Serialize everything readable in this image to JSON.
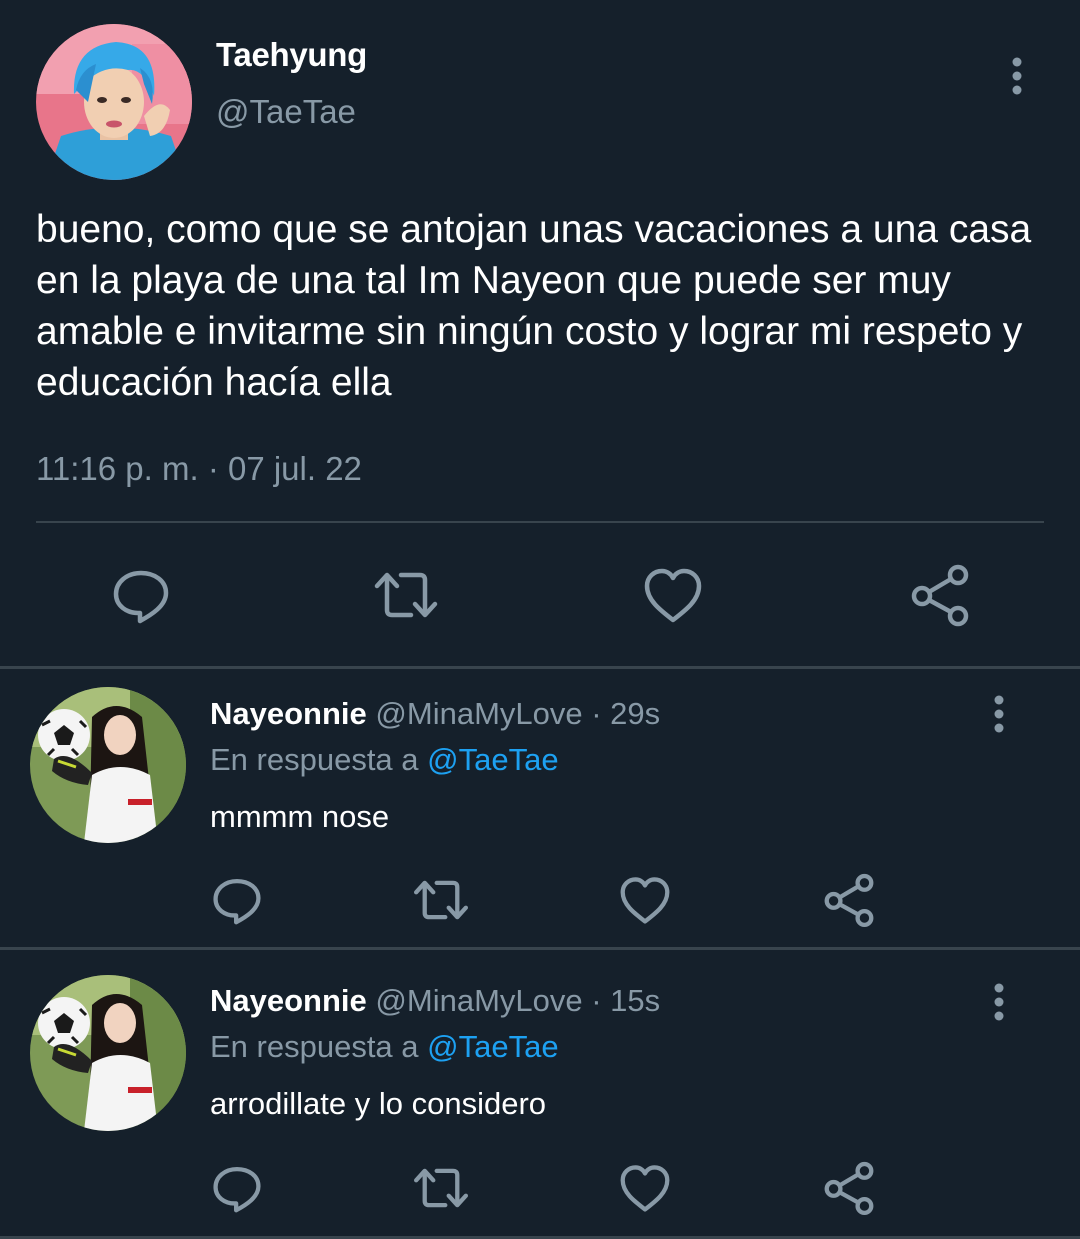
{
  "main_tweet": {
    "display_name": "Taehyung",
    "handle": "@TaeTae",
    "text": "bueno, como que se antojan unas vacaciones a una casa en la playa de una tal Im Nayeon que puede ser muy amable e invitarme sin ningún costo y lograr mi respeto y educación hacía ella",
    "timestamp": "11:16 p. m. · 07 jul. 22",
    "avatar": "blue-haired-man-avatar"
  },
  "replies": [
    {
      "display_name": "Nayeonnie",
      "handle_time": "@MinaMyLove · 29s",
      "replying_prefix": "En respuesta a",
      "replying_to": "@TaeTae",
      "text": "mmmm nose",
      "avatar": "woman-with-soccer-ball-avatar"
    },
    {
      "display_name": "Nayeonnie",
      "handle_time": "@MinaMyLove · 15s",
      "replying_prefix": "En respuesta a",
      "replying_to": "@TaeTae",
      "text": "arrodillate y lo considero",
      "avatar": "woman-with-soccer-ball-avatar"
    }
  ],
  "icons": {
    "reply": "reply-icon",
    "retweet": "retweet-icon",
    "like": "like-icon",
    "share": "share-icon",
    "more": "more-options-icon"
  },
  "colors": {
    "background": "#15202b",
    "secondary_text": "#8899a6",
    "accent": "#1da1f2",
    "divider": "#38444d"
  }
}
